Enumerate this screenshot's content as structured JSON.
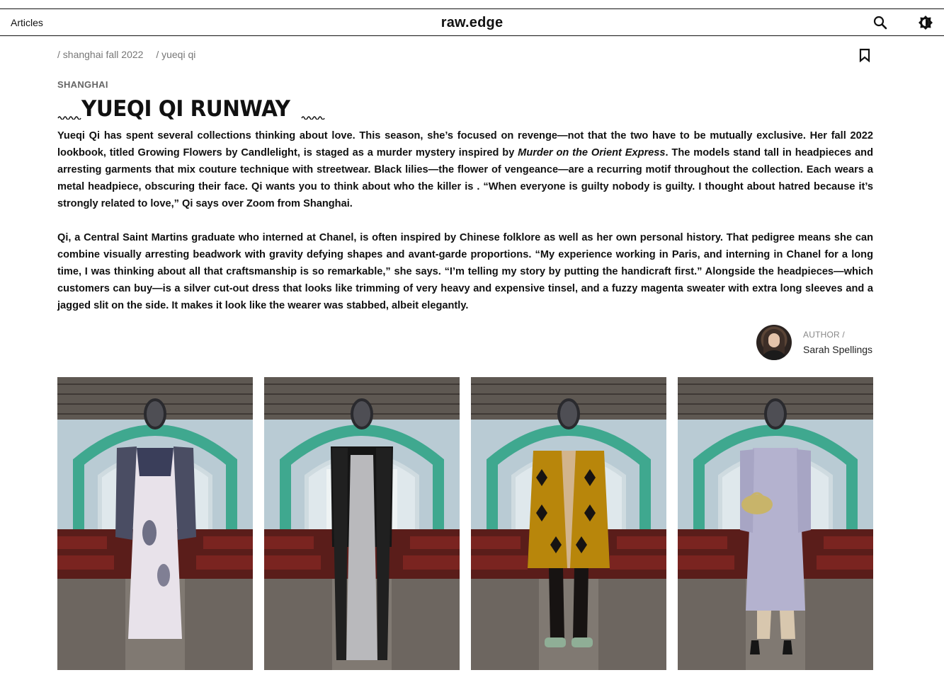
{
  "header": {
    "nav_articles": "Articles",
    "brand": "raw.edge",
    "search_icon": "search-icon",
    "theme_icon": "theme-toggle-icon"
  },
  "breadcrumbs": [
    "/ shanghai fall 2022",
    "/ yueqi qi"
  ],
  "article": {
    "kicker": "SHANGHAI",
    "title": "YUEQI QI RUNWAY",
    "paragraph1_start": "Yueqi Qi has spent several collections thinking about love. This season, she’s focused on revenge—not that the two have to be mutually exclusive. Her fall 2022 lookbook, titled Growing Flowers by Candlelight, is staged as a murder mystery inspired by ",
    "paragraph1_italic": "Murder on the Orient Express",
    "paragraph1_end": ". The models stand tall in headpieces and arresting garments that mix couture technique with streetwear. Black lilies—the flower of vengeance—are a recurring motif throughout the collection. Each wears a metal headpiece, obscuring their face. Qi wants you to think about who the killer is . “When everyone is guilty nobody is guilty. I thought about hatred because it’s strongly related to love,” Qi says over Zoom from Shanghai.",
    "paragraph2": "Qi, a Central Saint Martins graduate who interned at Chanel, is often inspired by Chinese folklore as well as her own personal history. That pedigree means she can combine visually arresting beadwork with gravity defying shapes and avant-garde proportions. “My experience working in Paris, and interning in Chanel for a long time, I was thinking about all that craftsmanship is so remarkable,” she says. “I’m telling my story by putting the handicraft first.” Alongside the headpieces—which customers can buy—is a silver cut-out dress that looks like trimming of very heavy and expensive tinsel, and a fuzzy magenta sweater with extra long sleeves and a jagged slit on the side. It makes it look like the wearer was stabbed, albeit elegantly."
  },
  "author": {
    "label": "AUTHOR /",
    "name": "Sarah Spellings"
  },
  "gallery": [
    {
      "name": "look-1",
      "garment": "#e8e2ea",
      "accent": "#3a3e5a"
    },
    {
      "name": "look-2",
      "garment": "#b9b9bc",
      "accent": "#151515"
    },
    {
      "name": "look-3",
      "garment": "#b8860b",
      "accent": "#171312"
    },
    {
      "name": "look-4",
      "garment": "#b4b2cf",
      "accent": "#c8b46a"
    }
  ],
  "colors": {
    "text": "#111111",
    "muted": "#777777",
    "arch_green": "#3fa88f"
  }
}
